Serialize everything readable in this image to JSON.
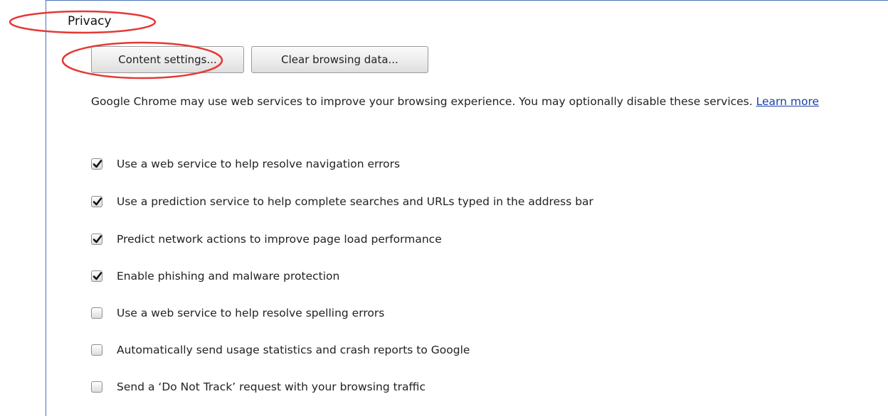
{
  "section": {
    "title": "Privacy"
  },
  "buttons": {
    "content_settings": "Content settings...",
    "clear_browsing_data": "Clear browsing data..."
  },
  "description": {
    "text": "Google Chrome may use web services to improve your browsing experience. You may optionally disable these services.",
    "link": "Learn more"
  },
  "options": [
    {
      "label": "Use a web service to help resolve navigation errors",
      "checked": true
    },
    {
      "label": "Use a prediction service to help complete searches and URLs typed in the address bar",
      "checked": true
    },
    {
      "label": "Predict network actions to improve page load performance",
      "checked": true
    },
    {
      "label": "Enable phishing and malware protection",
      "checked": true
    },
    {
      "label": "Use a web service to help resolve spelling errors",
      "checked": false
    },
    {
      "label": "Automatically send usage statistics and crash reports to Google",
      "checked": false
    },
    {
      "label": "Send a ‘Do Not Track’ request with your browsing traffic",
      "checked": false
    }
  ],
  "colors": {
    "annotation": "#e53935",
    "frame_border": "#4a72b8",
    "link": "#1a3fa8"
  },
  "icons": {
    "checked": "check-mark-icon"
  }
}
